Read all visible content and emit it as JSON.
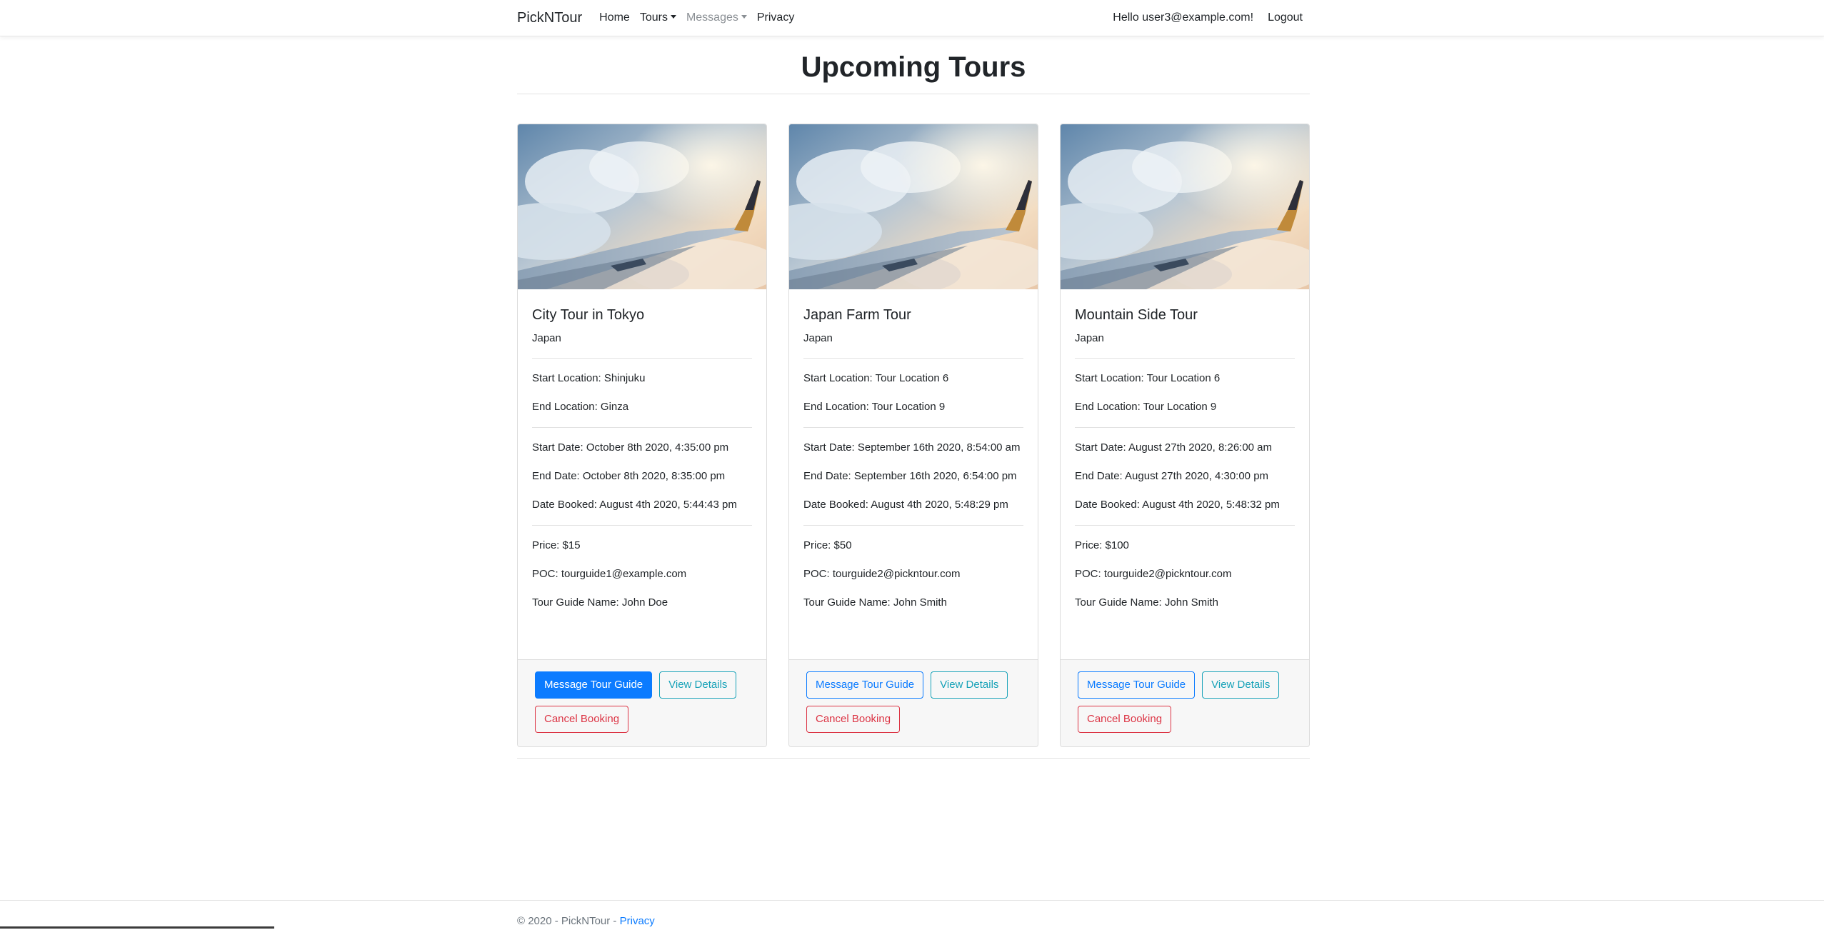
{
  "nav": {
    "brand": "PickNTour",
    "home": "Home",
    "tours": "Tours",
    "messages": "Messages",
    "privacy": "Privacy",
    "greeting": "Hello user3@example.com!",
    "logout": "Logout"
  },
  "page": {
    "title": "Upcoming Tours"
  },
  "tours": [
    {
      "name": "City Tour in Tokyo",
      "country": "Japan",
      "start_location": "Start Location: Shinjuku",
      "end_location": "End Location: Ginza",
      "start_date": "Start Date: October 8th 2020, 4:35:00 pm",
      "end_date": "End Date: October 8th 2020, 8:35:00 pm",
      "date_booked": "Date Booked: August 4th 2020, 5:44:43 pm",
      "price": "Price: $15",
      "poc": "POC: tourguide1@example.com",
      "guide": "Tour Guide Name: John Doe",
      "message_btn": "Message Tour Guide",
      "details_btn": "View Details",
      "cancel_btn": "Cancel Booking"
    },
    {
      "name": "Japan Farm Tour",
      "country": "Japan",
      "start_location": "Start Location: Tour Location 6",
      "end_location": "End Location: Tour Location 9",
      "start_date": "Start Date: September 16th 2020, 8:54:00 am",
      "end_date": "End Date: September 16th 2020, 6:54:00 pm",
      "date_booked": "Date Booked: August 4th 2020, 5:48:29 pm",
      "price": "Price: $50",
      "poc": "POC: tourguide2@pickntour.com",
      "guide": "Tour Guide Name: John Smith",
      "message_btn": "Message Tour Guide",
      "details_btn": "View Details",
      "cancel_btn": "Cancel Booking"
    },
    {
      "name": "Mountain Side Tour",
      "country": "Japan",
      "start_location": "Start Location: Tour Location 6",
      "end_location": "End Location: Tour Location 9",
      "start_date": "Start Date: August 27th 2020, 8:26:00 am",
      "end_date": "End Date: August 27th 2020, 4:30:00 pm",
      "date_booked": "Date Booked: August 4th 2020, 5:48:32 pm",
      "price": "Price: $100",
      "poc": "POC: tourguide2@pickntour.com",
      "guide": "Tour Guide Name: John Smith",
      "message_btn": "Message Tour Guide",
      "details_btn": "View Details",
      "cancel_btn": "Cancel Booking"
    }
  ],
  "footer": {
    "copyright": "© 2020 - PickNTour - ",
    "privacy": "Privacy"
  },
  "colors": {
    "primary": "#0b7bff",
    "info": "#17a2b8",
    "danger": "#dc3545"
  }
}
